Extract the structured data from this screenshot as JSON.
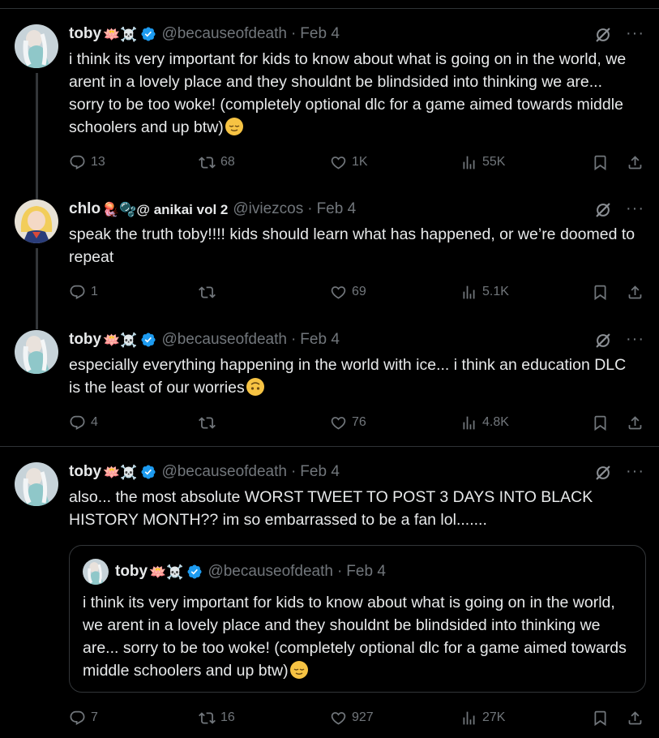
{
  "tweets": [
    {
      "name": "toby",
      "emoji": "🪷☠️",
      "handle": "@becauseofdeath",
      "date": "Feb 4",
      "text": "i think its very important for kids to know about what is going on in the world, we arent in a lovely place and they shouldnt be blindsided into thinking we are... sorry to be too woke! (completely optional dlc for a game aimed towards middle schoolers and up btw)",
      "stats": {
        "replies": "13",
        "reposts": "68",
        "likes": "1K",
        "views": "55K"
      }
    },
    {
      "name": "chlo",
      "emoji": "🪼🫧@ anikai vol 2",
      "handle": "@iviezcos",
      "date": "Feb 4",
      "text": "speak the truth toby!!!! kids should learn what has happened, or we’re doomed to repeat",
      "stats": {
        "replies": "1",
        "reposts": "",
        "likes": "69",
        "views": "5.1K"
      }
    },
    {
      "name": "toby",
      "emoji": "🪷☠️",
      "handle": "@becauseofdeath",
      "date": "Feb 4",
      "text": "especially everything happening in the world with ice... i think an education DLC is the least of our worries",
      "stats": {
        "replies": "4",
        "reposts": "",
        "likes": "76",
        "views": "4.8K"
      }
    },
    {
      "name": "toby",
      "emoji": "🪷☠️",
      "handle": "@becauseofdeath",
      "date": "Feb 4",
      "text": "also... the most absolute WORST TWEET TO POST 3 DAYS INTO BLACK HISTORY MONTH?? im so embarrassed to be a fan lol.......",
      "stats": {
        "replies": "7",
        "reposts": "16",
        "likes": "927",
        "views": "27K"
      }
    }
  ],
  "quote": {
    "name": "toby",
    "emoji": "🪷☠️",
    "handle": "@becauseofdeath",
    "date": "Feb 4",
    "text": "i think its very important for kids to know about what is going on in the world, we arent in a lovely place and they shouldnt be blindsided into thinking we are... sorry to be too woke! (completely optional dlc for a game aimed towards middle schoolers and up btw)"
  },
  "ui": {
    "dot": "·",
    "more": "···"
  },
  "icons": {
    "reply": "reply-icon",
    "repost": "repost-icon",
    "like": "heart-icon",
    "views": "views-icon",
    "bookmark": "bookmark-icon",
    "share": "share-icon",
    "grok": "grok-icon",
    "verified": "verified-badge-icon"
  },
  "colors": {
    "background": "#000000",
    "text": "#e7e9ea",
    "muted": "#71767b",
    "verified": "#1d9bf0",
    "border": "#2f3336"
  }
}
